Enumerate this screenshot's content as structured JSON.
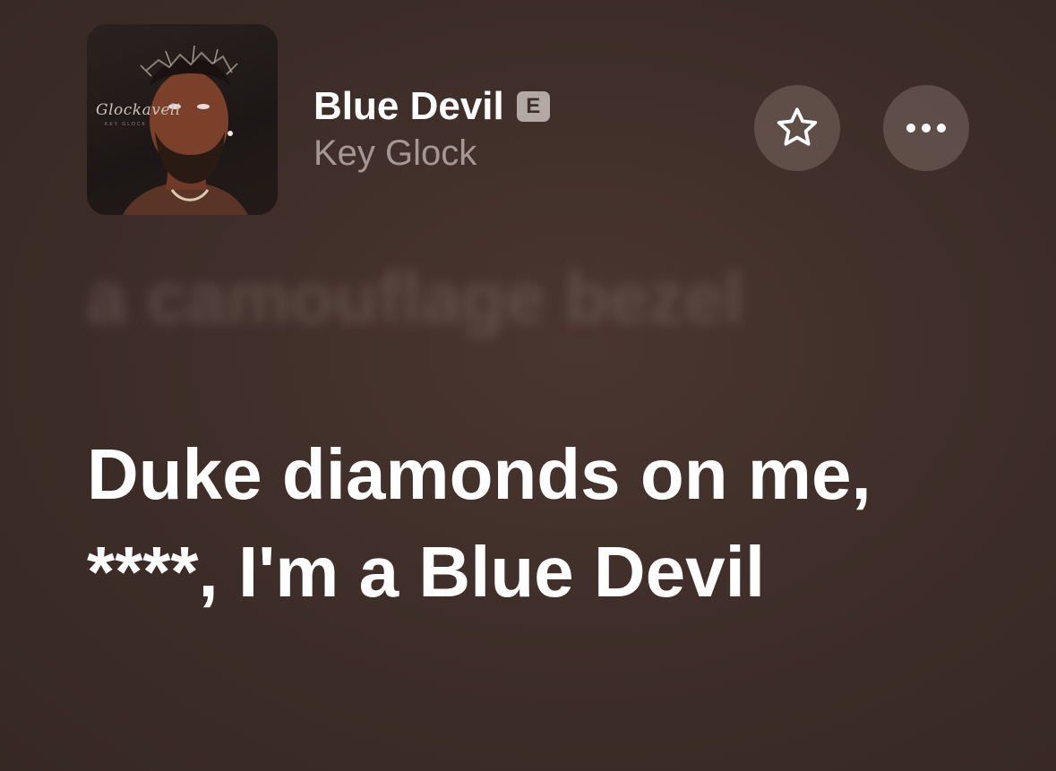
{
  "now_playing": {
    "artwork": {
      "label": "Glockaveli",
      "sublabel": "KEY GLOCK"
    },
    "title": "Blue Devil",
    "explicit_badge": "E",
    "artist": "Key Glock",
    "favorite_icon": "star-outline-icon",
    "more_icon": "ellipsis-icon"
  },
  "lyrics": {
    "previous_line": "a camouflage bezel",
    "current_line": "Duke diamonds on me, ****, I'm a Blue Devil"
  },
  "colors": {
    "background": "#3f2e29",
    "text_primary": "#ffffff",
    "text_secondary": "#a59894",
    "badge": "#b3a8a4"
  }
}
